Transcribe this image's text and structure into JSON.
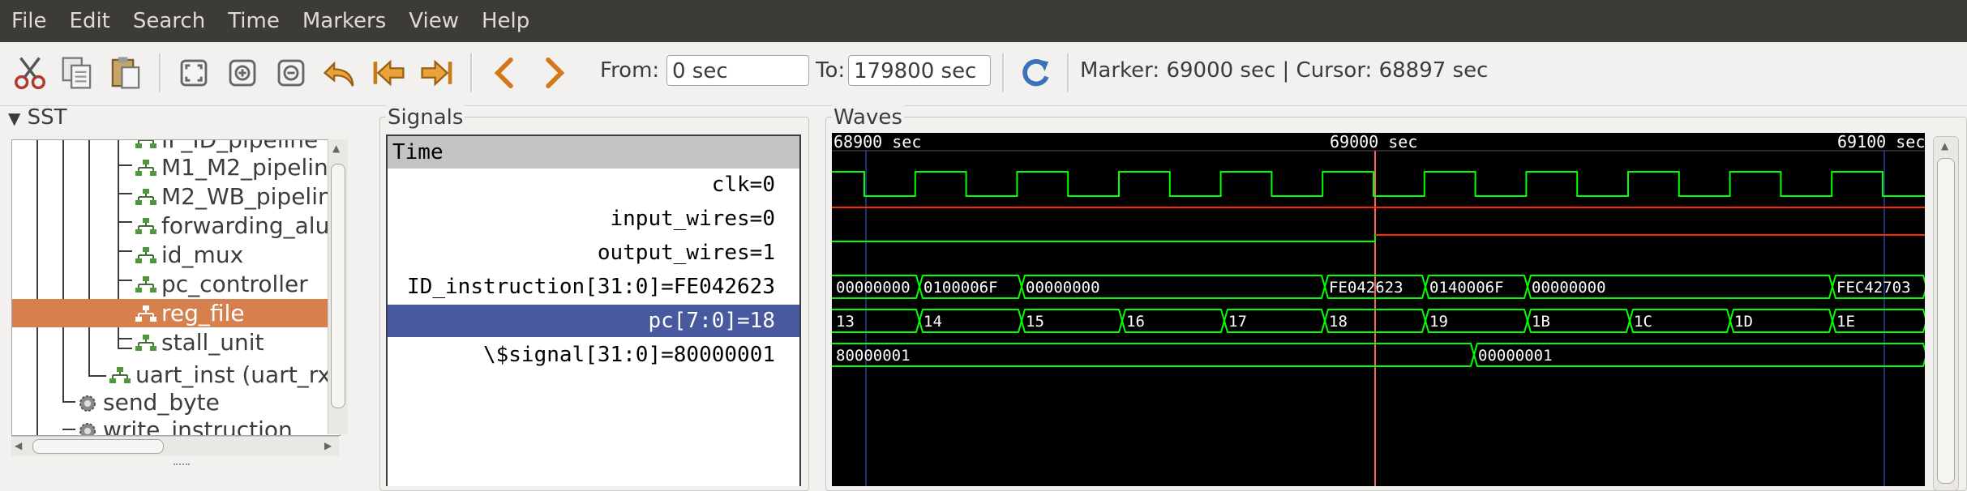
{
  "menu": [
    "File",
    "Edit",
    "Search",
    "Time",
    "Markers",
    "View",
    "Help"
  ],
  "toolbar": {
    "from_label": "From:",
    "from_value": "0 sec",
    "to_label": "To:",
    "to_value": "179800 sec",
    "status": "Marker: 69000 sec  |  Cursor: 68897 sec"
  },
  "sst": {
    "title": "SST",
    "items": [
      {
        "label": "IF_ID_pipeline",
        "level": 4
      },
      {
        "label": "M1_M2_pipelin",
        "level": 4
      },
      {
        "label": "M2_WB_pipelin",
        "level": 4
      },
      {
        "label": "forwarding_alu",
        "level": 4
      },
      {
        "label": "id_mux",
        "level": 4
      },
      {
        "label": "pc_controller",
        "level": 4
      },
      {
        "label": "reg_file",
        "level": 4,
        "selected": true
      },
      {
        "label": "stall_unit",
        "level": 4
      },
      {
        "label": "uart_inst (uart_rx",
        "level": 3
      },
      {
        "label": "send_byte",
        "level": 2
      },
      {
        "label": "write_instruction",
        "level": 2
      }
    ]
  },
  "signals": {
    "title": "Signals",
    "header": "Time",
    "rows": [
      {
        "label": "clk=0"
      },
      {
        "label": "input_wires=0"
      },
      {
        "label": "output_wires=1"
      },
      {
        "label": "ID_instruction[31:0]=FE042623"
      },
      {
        "label": "pc[7:0]=18",
        "selected": true
      },
      {
        "label": "\\$signal[31:0]=80000001"
      }
    ]
  },
  "waves": {
    "title": "Waves",
    "ticks": [
      "68900 sec",
      "69000 sec",
      "69100 sec"
    ],
    "id_instruction": [
      "00000000",
      "0100006F",
      "00000000",
      "FE042623",
      "0140006F",
      "00000000",
      "FEC42703"
    ],
    "pc": [
      "13",
      "14",
      "15",
      "16",
      "17",
      "18",
      "19",
      "1B",
      "1C",
      "1D",
      "1E"
    ],
    "signal": [
      "80000001",
      "00000001"
    ]
  },
  "colors": {
    "wave": "#00ff00",
    "low_red": "#ff2a00",
    "marker": "#ff6060",
    "selection_signals": "#4859a0",
    "selection_sst": "#d5804d"
  }
}
